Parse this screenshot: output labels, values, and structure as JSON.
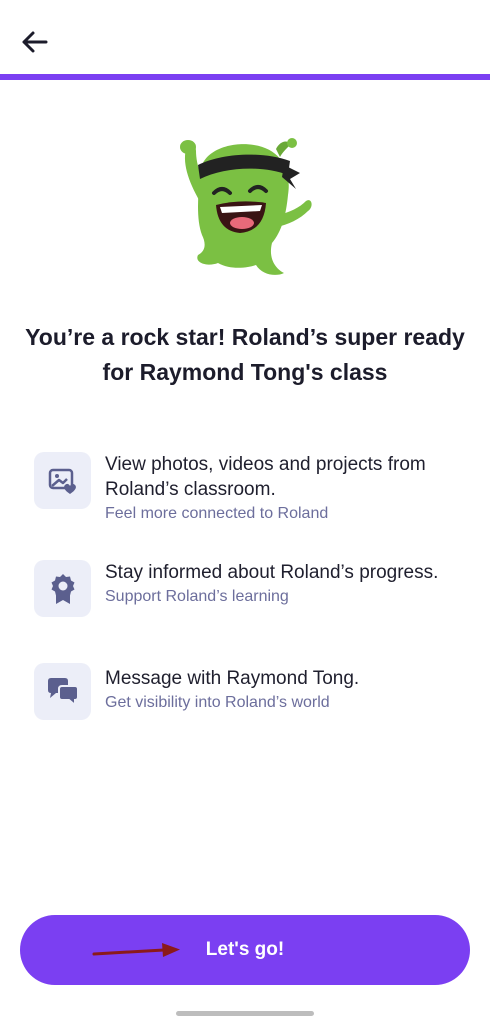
{
  "header": {
    "back_icon": "arrow-left-icon"
  },
  "progress": {
    "value": 1.0,
    "color": "#7b3ff2"
  },
  "mascot": {
    "icon": "green-monster-mascot",
    "color": "#7bc043"
  },
  "headline": "You’re a rock star! Roland’s super ready for  Raymond Tong's class",
  "features": [
    {
      "icon": "photo-heart-icon",
      "title": "View photos, videos and projects from Roland’s classroom.",
      "subtitle": "Feel more connected to Roland"
    },
    {
      "icon": "award-ribbon-icon",
      "title": "Stay informed about Roland’s progress.",
      "subtitle": "Support Roland’s learning"
    },
    {
      "icon": "chat-bubbles-icon",
      "title": "Message with  Raymond Tong.",
      "subtitle": "Get visibility into Roland’s world"
    }
  ],
  "cta": {
    "label": "Let's go!",
    "color": "#7b3ff2"
  },
  "annotation": {
    "arrow_color": "#8b1a1a"
  }
}
